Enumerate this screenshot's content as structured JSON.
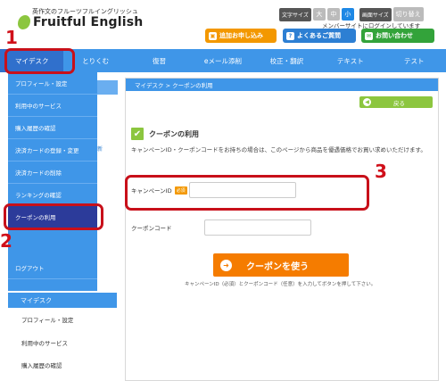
{
  "header": {
    "tagline": "英作文のフルーツフルイングリッシュ",
    "logo_text": "Fruitful English",
    "textsize_label": "文字サイズ",
    "textsize_options": [
      "大",
      "中",
      "小"
    ],
    "screensize_label": "画面サイズ",
    "switch_label": "切り替え",
    "login_status": "メンバーサイトにログインしています",
    "btn_apply": "追加お申し込み",
    "btn_faq": "よくあるご質問",
    "btn_contact": "お問い合わせ"
  },
  "nav": {
    "items": [
      "マイデスク",
      "とりくむ",
      "復習",
      "eメール添削",
      "校正・翻訳",
      "テキスト",
      "テスト"
    ]
  },
  "dropdown": {
    "items": [
      "プロフィール・設定",
      "利用中のサービス",
      "購入履歴の確認",
      "決済カードの登録・変更",
      "決済カードの削除",
      "ランキングの確認",
      "クーポンの利用",
      "ログアウト"
    ]
  },
  "behind": {
    "link_fragment": "新"
  },
  "sidebar": {
    "heading": "マイデスク",
    "links": [
      "プロフィール・設定",
      "利用中のサービス",
      "購入履歴の確認"
    ]
  },
  "main": {
    "breadcrumb": "マイデスク > クーポンの利用",
    "back_label": "戻る",
    "title": "クーポンの利用",
    "description": "キャンペーンID・クーポンコードをお持ちの場合は、このページから商品を優遇価格でお買い求めいただけます。",
    "campaign_label": "キャンペーンID",
    "required_badge": "必須",
    "coupon_label": "クーポンコード",
    "campaign_value": "",
    "coupon_value": "",
    "submit_label": "クーポンを使う",
    "hint": "キャンペーンID（必須）とクーポンコード（任意）を入力してボタンを押して下さい。"
  },
  "annotations": {
    "step1": "1",
    "step2": "2",
    "step3": "3"
  },
  "colors": {
    "nav_blue": "#3f96e8",
    "active_item": "#2c3b9a",
    "accent_orange": "#f57c00",
    "green": "#8cc63f",
    "marker_red": "#d0101a"
  }
}
